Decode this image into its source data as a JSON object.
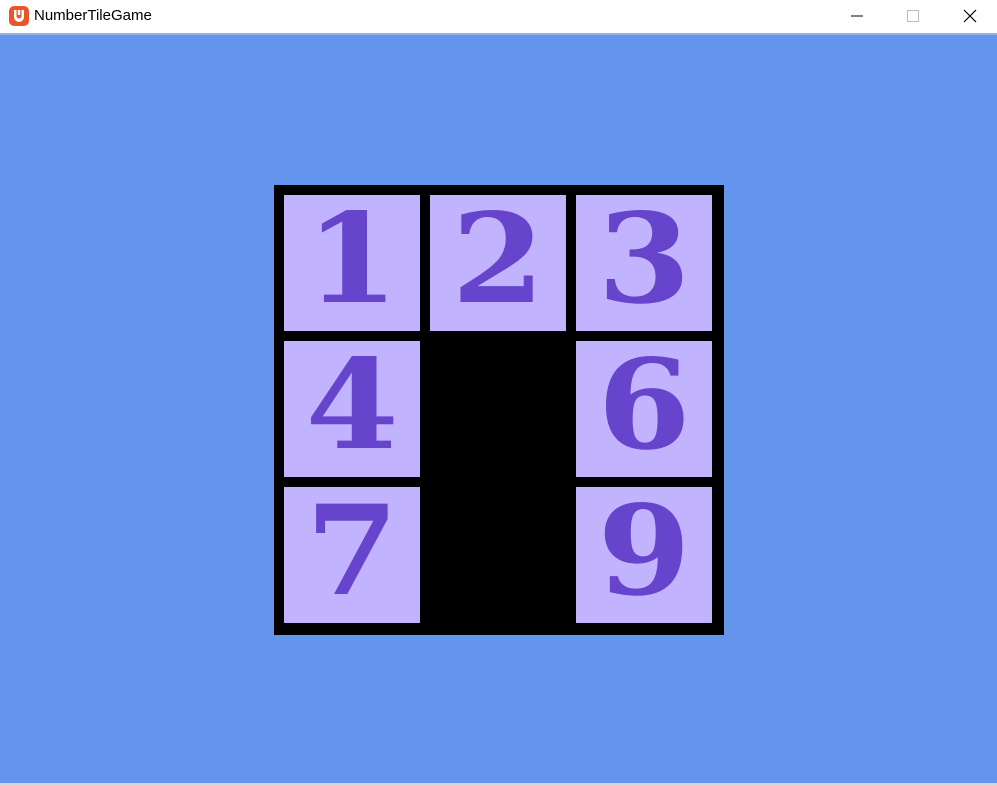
{
  "window": {
    "title": "NumberTileGame",
    "app_icon": "monogame-logo-icon",
    "controls": {
      "minimize": "minimize-icon",
      "maximize": "maximize-icon",
      "close": "close-icon"
    }
  },
  "colors": {
    "background": "#6495ed",
    "board": "#000000",
    "tile": "#c2b3ff",
    "tile_number": "#6644cc",
    "app_icon": "#e8562a"
  },
  "board": {
    "rows": 3,
    "columns": 3,
    "tiles": [
      "1",
      "2",
      "3",
      "4",
      null,
      "6",
      "7",
      null,
      "9"
    ]
  }
}
